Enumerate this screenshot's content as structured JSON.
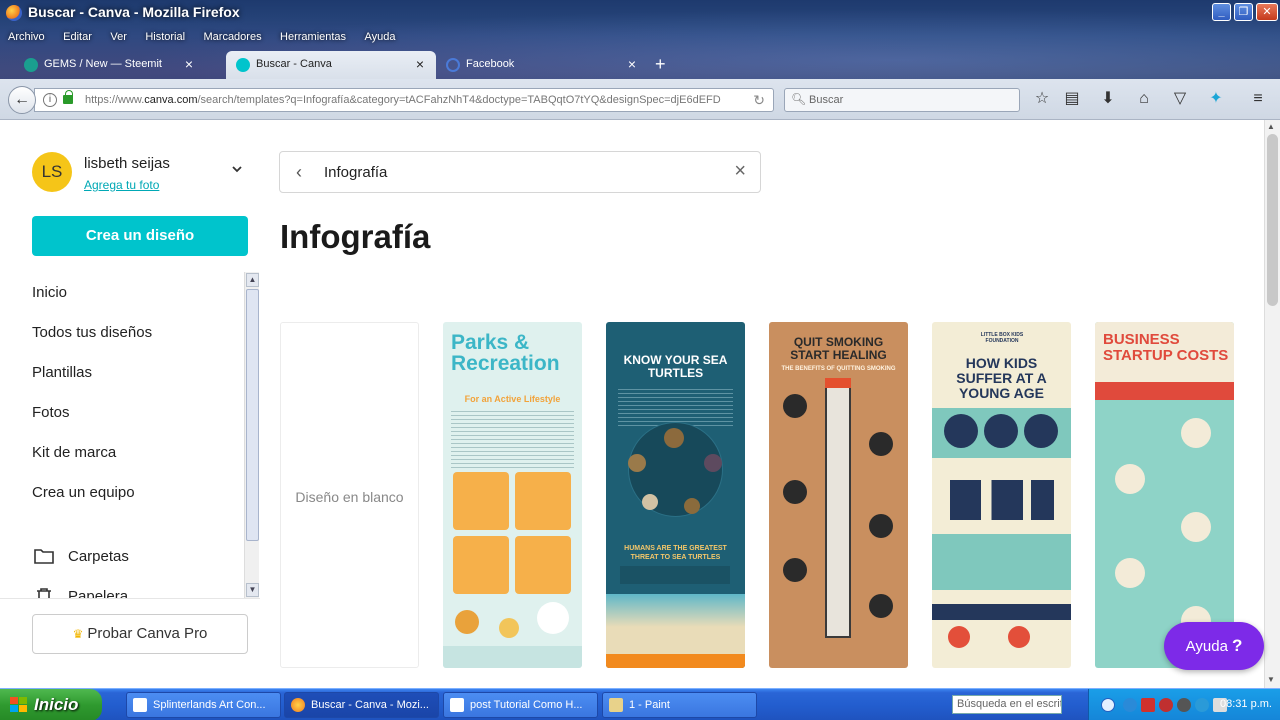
{
  "window": {
    "title": "Buscar - Canva - Mozilla Firefox"
  },
  "menubar": [
    "Archivo",
    "Editar",
    "Ver",
    "Historial",
    "Marcadores",
    "Herramientas",
    "Ayuda"
  ],
  "tabs": [
    {
      "label": "GEMS / New — Steemit",
      "favicon_color": "#1a9f8f"
    },
    {
      "label": "Buscar - Canva",
      "favicon_color": "#00c4cc"
    },
    {
      "label": "Facebook",
      "favicon_color": "#3b5998"
    }
  ],
  "navbar": {
    "url_prefix": "https://www.",
    "url_domain": "canva.com",
    "url_rest": "/search/templates?q=Infografía&category=tACFahzNhT4&doctype=TABQqtO7tYQ&designSpec=djE6dEFD",
    "search_placeholder": "Buscar"
  },
  "user": {
    "initials": "LS",
    "name": "lisbeth seijas",
    "add_photo": "Agrega tu foto"
  },
  "sidebar": {
    "create_button": "Crea un diseño",
    "items": [
      "Inicio",
      "Todos tus diseños",
      "Plantillas",
      "Fotos",
      "Kit de marca",
      "Crea un equipo"
    ],
    "folders": [
      "Carpetas",
      "Papelera"
    ],
    "pro_button": "Probar Canva Pro"
  },
  "search": {
    "query": "Infografía"
  },
  "main": {
    "title": "Infografía",
    "blank_label": "Diseño en blanco",
    "templates": [
      {
        "title": "Parks & Recreation",
        "subtitle": "For an Active Lifestyle",
        "bg": "#dff1ee",
        "accent": "#3cb6c7"
      },
      {
        "title": "KNOW YOUR SEA TURTLES",
        "subtitle": "HUMANS ARE THE GREATEST THREAT TO SEA TURTLES",
        "bg": "#1e5f74",
        "accent": "#f5a623"
      },
      {
        "title": "QUIT SMOKING START HEALING",
        "subtitle": "THE BENEFITS OF QUITTING SMOKING",
        "bg": "#c98f5f",
        "accent": "#2a2a2a"
      },
      {
        "title": "HOW KIDS SUFFER AT A YOUNG AGE",
        "subtitle": "LITTLE BOX KIDS FOUNDATION",
        "bg": "#f3edd6",
        "accent": "#24375b"
      },
      {
        "title": "BUSINESS STARTUP COSTS",
        "subtitle": "",
        "bg": "#8ed3c7",
        "accent": "#e04a3c"
      }
    ],
    "help_label": "Ayuda"
  },
  "taskbar": {
    "start": "Inicio",
    "tasks": [
      "Splinterlands Art Con...",
      "Buscar - Canva - Mozi...",
      "post Tutorial Como H...",
      "1 - Paint"
    ],
    "search_placeholder": "Búsqueda en el escrito",
    "clock": "08:31 p.m."
  }
}
